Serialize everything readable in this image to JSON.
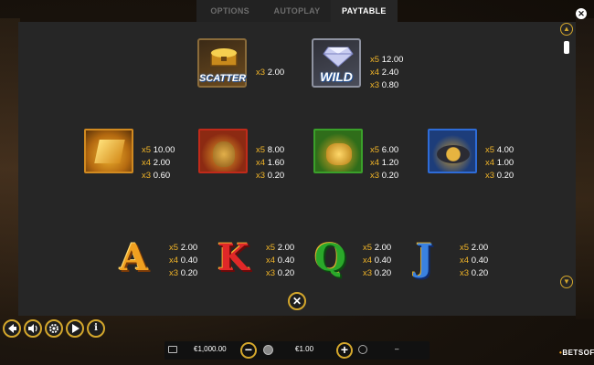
{
  "tabs": [
    {
      "label": "OPTIONS",
      "active": false
    },
    {
      "label": "AUTOPLAY",
      "active": false
    },
    {
      "label": "PAYTABLE",
      "active": true
    }
  ],
  "symbols": {
    "scatter": {
      "label": "SCATTER",
      "pays": [
        {
          "mul": "x3",
          "val": "2.00"
        }
      ]
    },
    "wild": {
      "label": "WILD",
      "pays": [
        {
          "mul": "x5",
          "val": "12.00"
        },
        {
          "mul": "x4",
          "val": "2.40"
        },
        {
          "mul": "x3",
          "val": "0.80"
        }
      ]
    },
    "gold_bars": {
      "pays": [
        {
          "mul": "x5",
          "val": "10.00"
        },
        {
          "mul": "x4",
          "val": "2.00"
        },
        {
          "mul": "x3",
          "val": "0.60"
        }
      ]
    },
    "gold_sack": {
      "pays": [
        {
          "mul": "x5",
          "val": "8.00"
        },
        {
          "mul": "x4",
          "val": "1.60"
        },
        {
          "mul": "x3",
          "val": "0.20"
        }
      ]
    },
    "gold_nuggets": {
      "pays": [
        {
          "mul": "x5",
          "val": "6.00"
        },
        {
          "mul": "x4",
          "val": "1.20"
        },
        {
          "mul": "x3",
          "val": "0.20"
        }
      ]
    },
    "gold_pan": {
      "pays": [
        {
          "mul": "x5",
          "val": "4.00"
        },
        {
          "mul": "x4",
          "val": "1.00"
        },
        {
          "mul": "x3",
          "val": "0.20"
        }
      ]
    },
    "ace": {
      "letter": "A",
      "pays": [
        {
          "mul": "x5",
          "val": "2.00"
        },
        {
          "mul": "x4",
          "val": "0.40"
        },
        {
          "mul": "x3",
          "val": "0.20"
        }
      ]
    },
    "king": {
      "letter": "K",
      "pays": [
        {
          "mul": "x5",
          "val": "2.00"
        },
        {
          "mul": "x4",
          "val": "0.40"
        },
        {
          "mul": "x3",
          "val": "0.20"
        }
      ]
    },
    "queen": {
      "letter": "Q",
      "pays": [
        {
          "mul": "x5",
          "val": "2.00"
        },
        {
          "mul": "x4",
          "val": "0.40"
        },
        {
          "mul": "x3",
          "val": "0.20"
        }
      ]
    },
    "jack": {
      "letter": "J",
      "pays": [
        {
          "mul": "x5",
          "val": "2.00"
        },
        {
          "mul": "x4",
          "val": "0.40"
        },
        {
          "mul": "x3",
          "val": "0.20"
        }
      ]
    }
  },
  "controls": {
    "back_icon": "back-arrow-icon",
    "sound_icon": "speaker-icon",
    "settings_icon": "gear-icon",
    "play_icon": "play-icon",
    "info_icon": "info-icon",
    "info_glyph": "i",
    "close_glyph": "✕"
  },
  "footer": {
    "balance": "€1,000.00",
    "bet": "€1.00",
    "win": "–",
    "minus": "−",
    "plus": "+"
  },
  "logo": {
    "text": "BETSOFT",
    "dot": "•"
  },
  "colors": {
    "accent_gold": "#d4a72c",
    "panel": "#262626",
    "multiplier": "#f0b428"
  }
}
